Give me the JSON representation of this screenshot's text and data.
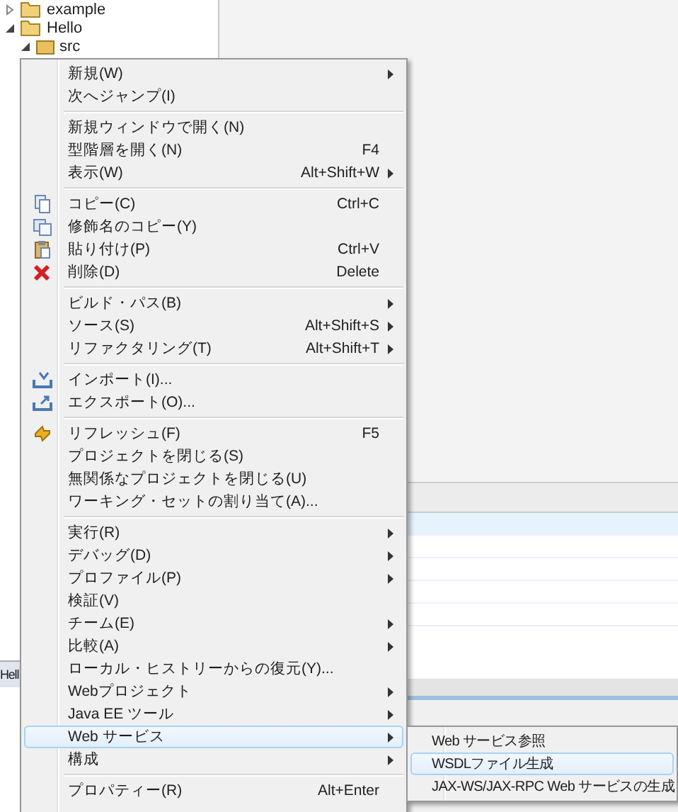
{
  "tree": [
    {
      "label": "example",
      "expanded": false,
      "kind": "project"
    },
    {
      "label": "Hello",
      "expanded": true,
      "kind": "project"
    },
    {
      "label": "src",
      "expanded": true,
      "kind": "folder"
    }
  ],
  "bottom_tab": {
    "label": "Hell"
  },
  "context_menu": {
    "groups": [
      [
        {
          "label": "新規(W)",
          "submenu": true,
          "kind": "plain",
          "selected": false
        },
        {
          "label": "次へジャンプ(I)",
          "submenu": false,
          "kind": "plain",
          "selected": false
        }
      ],
      [
        {
          "label": "新規ウィンドウで開く(N)",
          "submenu": false,
          "kind": "plain",
          "selected": false
        },
        {
          "label": "型階層を開く(N)",
          "shortcut": "F4",
          "submenu": false,
          "kind": "plain",
          "selected": false
        },
        {
          "label": "表示(W)",
          "shortcut": "Alt+Shift+W",
          "submenu": true,
          "kind": "plain",
          "selected": false
        }
      ],
      [
        {
          "label": "コピー(C)",
          "shortcut": "Ctrl+C",
          "submenu": false,
          "kind": "copy",
          "selected": false
        },
        {
          "label": "修飾名のコピー(Y)",
          "submenu": false,
          "kind": "copy-name",
          "selected": false
        },
        {
          "label": "貼り付け(P)",
          "shortcut": "Ctrl+V",
          "submenu": false,
          "kind": "paste",
          "selected": false
        },
        {
          "label": "削除(D)",
          "shortcut": "Delete",
          "submenu": false,
          "kind": "delete",
          "selected": false
        }
      ],
      [
        {
          "label": "ビルド・パス(B)",
          "submenu": true,
          "kind": "plain",
          "selected": false
        },
        {
          "label": "ソース(S)",
          "shortcut": "Alt+Shift+S",
          "submenu": true,
          "kind": "plain",
          "selected": false
        },
        {
          "label": "リファクタリング(T)",
          "shortcut": "Alt+Shift+T",
          "submenu": true,
          "kind": "plain",
          "selected": false
        }
      ],
      [
        {
          "label": "インポート(I)...",
          "submenu": false,
          "kind": "import",
          "selected": false
        },
        {
          "label": "エクスポート(O)...",
          "submenu": false,
          "kind": "export",
          "selected": false
        }
      ],
      [
        {
          "label": "リフレッシュ(F)",
          "shortcut": "F5",
          "submenu": false,
          "kind": "refresh",
          "selected": false
        },
        {
          "label": "プロジェクトを閉じる(S)",
          "submenu": false,
          "kind": "plain",
          "selected": false
        },
        {
          "label": "無関係なプロジェクトを閉じる(U)",
          "submenu": false,
          "kind": "plain",
          "selected": false
        },
        {
          "label": "ワーキング・セットの割り当て(A)...",
          "submenu": false,
          "kind": "plain",
          "selected": false
        }
      ],
      [
        {
          "label": "実行(R)",
          "submenu": true,
          "kind": "plain",
          "selected": false
        },
        {
          "label": "デバッグ(D)",
          "submenu": true,
          "kind": "plain",
          "selected": false
        },
        {
          "label": "プロファイル(P)",
          "submenu": true,
          "kind": "plain",
          "selected": false
        },
        {
          "label": "検証(V)",
          "submenu": false,
          "kind": "plain",
          "selected": false
        },
        {
          "label": "チーム(E)",
          "submenu": true,
          "kind": "plain",
          "selected": false
        },
        {
          "label": "比較(A)",
          "submenu": true,
          "kind": "plain",
          "selected": false
        },
        {
          "label": "ローカル・ヒストリーからの復元(Y)...",
          "submenu": false,
          "kind": "plain",
          "selected": false
        },
        {
          "label": "Webプロジェクト",
          "submenu": true,
          "kind": "plain",
          "selected": false
        },
        {
          "label": "Java EE ツール",
          "submenu": true,
          "kind": "plain",
          "selected": false
        },
        {
          "label": "Web サービス",
          "submenu": true,
          "kind": "plain",
          "selected": true
        },
        {
          "label": "構成",
          "submenu": true,
          "kind": "plain",
          "selected": false
        }
      ],
      [
        {
          "label": "プロパティー(R)",
          "shortcut": "Alt+Enter",
          "submenu": false,
          "kind": "plain",
          "selected": false
        }
      ]
    ]
  },
  "submenu": {
    "items": [
      {
        "label": "Web サービス参照",
        "selected": false
      },
      {
        "label": "WSDLファイル生成",
        "selected": true
      },
      {
        "label": "JAX-WS/JAX-RPC Web サービスの生成",
        "selected": false
      }
    ]
  }
}
